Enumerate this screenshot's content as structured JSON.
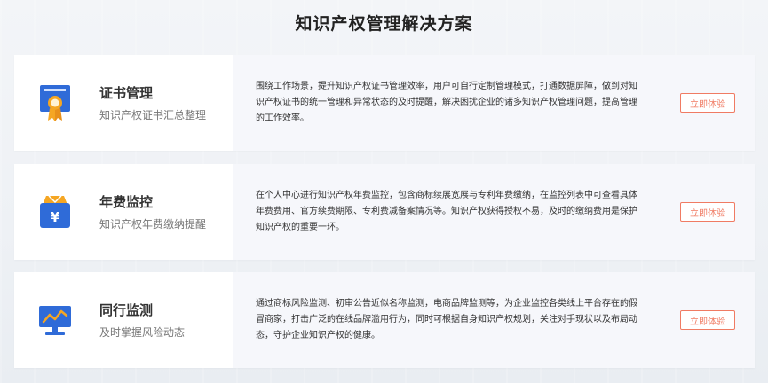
{
  "page": {
    "title": "知识产权管理解决方案"
  },
  "cards": [
    {
      "name": "证书管理",
      "subtitle": "知识产权证书汇总整理",
      "description": "围绕工作场景，提升知识产权证书管理效率，用户可自行定制管理模式，打通数据屏障，做到对知识产权证书的统一管理和异常状态的及时提醒，解决困扰企业的诸多知识产权管理问题，提高管理的工作效率。",
      "button": "立即体验",
      "icon": "certificate-icon"
    },
    {
      "name": "年费监控",
      "subtitle": "知识产权年费缴纳提醒",
      "description": "在个人中心进行知识产权年费监控，包含商标续展宽展与专利年费缴纳，在监控列表中可查看具体年费费用、官方续费期限、专利费减备案情况等。知识产权获得授权不易，及时的缴纳费用是保护知识产权的重要一环。",
      "button": "立即体验",
      "icon": "fee-wallet-icon",
      "icon_glyph": "¥"
    },
    {
      "name": "同行监测",
      "subtitle": "及时掌握风险动态",
      "description": "通过商标风险监测、初审公告近似名称监测，电商品牌监测等，为企业监控各类线上平台存在的假冒商家，打击广泛的在线品牌滥用行为，同时可根据自身知识产权规划，关注对手现状以及布局动态，守护企业知识产权的健康。",
      "button": "立即体验",
      "icon": "monitor-chart-icon"
    }
  ],
  "colors": {
    "accent_blue": "#2f6bd8",
    "accent_orange": "#f5a623",
    "button_border": "#f07b63"
  }
}
